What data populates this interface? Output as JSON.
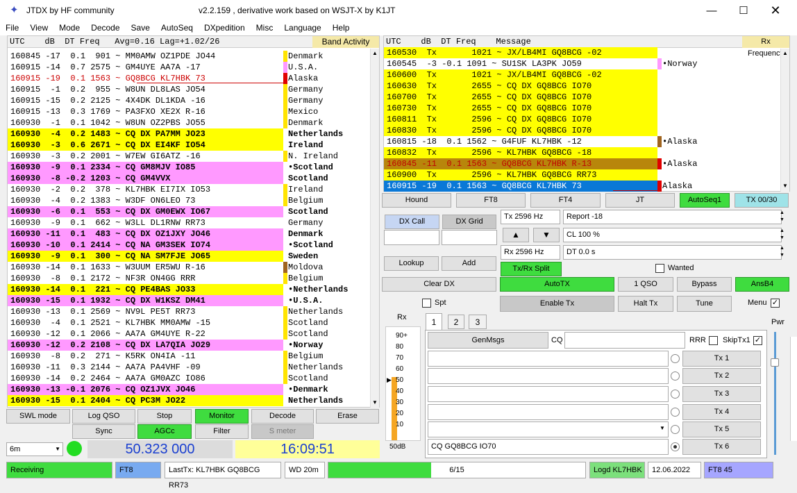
{
  "window": {
    "app_title": "JTDX  by HF community",
    "subtitle": "v2.2.159 , derivative work based on WSJT-X by K1JT"
  },
  "menu": [
    "File",
    "View",
    "Mode",
    "Decode",
    "Save",
    "AutoSeq",
    "DXpedition",
    "Misc",
    "Language",
    "Help"
  ],
  "left_panel": {
    "header": "UTC    dB  DT Freq   Avg=0.16 Lag=+1.02/26",
    "band_activity_label": "Band Activity",
    "rows": [
      {
        "text": "160845 -17  0.1  901 ~ MM0AMW OZ1PDE JO44",
        "country": "Denmark",
        "bg": "#ffffff",
        "fg": "#000",
        "marker": "#ffe400",
        "bold": false
      },
      {
        "text": "160915 -14  0.7 2575 ~ GM4UYE AA7A -17",
        "country": "U.S.A.",
        "bg": "#ffffff",
        "fg": "#000",
        "marker": "#ff99ff",
        "bold": false
      },
      {
        "text": "160915 -19  0.1 1563 ~ GQ8BCG KL7HBK 73",
        "country": "Alaska",
        "bg": "#ffffff",
        "fg": "#cc0000",
        "marker": "#e00000",
        "bold": false
      },
      {
        "text": "160915  -1  0.2  955 ~ W8UN DL8LAS JO54",
        "country": "Germany",
        "bg": "#ffffff",
        "fg": "#000",
        "marker": "#ffe400",
        "bold": false
      },
      {
        "text": "160915 -15  0.2 2125 ~ 4X4DK DL1KDA -16",
        "country": "Germany",
        "bg": "#ffffff",
        "fg": "#000",
        "marker": "#ffe400",
        "bold": false
      },
      {
        "text": "160915 -13  0.3 1769 ~ PA3FXO XE2X R-16",
        "country": "Mexico",
        "bg": "#ffffff",
        "fg": "#000",
        "marker": "#ffe400",
        "bold": false
      },
      {
        "text": "160930  -1  0.1 1042 ~ W8UN OZ2PBS JO55",
        "country": "Denmark",
        "bg": "#ffffff",
        "fg": "#000",
        "marker": "#ffe400",
        "bold": false
      },
      {
        "text": "160930  -4  0.2 1483 ~ CQ DX PA7MM JO23",
        "country": "Netherlands",
        "bg": "#ffff00",
        "fg": "#000",
        "marker": "",
        "bold": true
      },
      {
        "text": "160930  -3  0.6 2671 ~ CQ DX EI4KF IO54",
        "country": "Ireland",
        "bg": "#ffff00",
        "fg": "#000",
        "marker": "",
        "bold": true
      },
      {
        "text": "160930  -3  0.2 2001 ~ W7EW GI6ATZ -16",
        "country": "N. Ireland",
        "bg": "#ffffff",
        "fg": "#000",
        "marker": "#ffe400",
        "bold": false
      },
      {
        "text": "160930  -9  0.1 2334 ~ CQ GM8MJV IO85",
        "country": "•Scotland",
        "bg": "#ff99ff",
        "fg": "#000",
        "marker": "",
        "bold": true
      },
      {
        "text": "160930  -8 -0.2 1203 ~ CQ GM4VVX",
        "country": "Scotland",
        "bg": "#ff99ff",
        "fg": "#000",
        "marker": "",
        "bold": true
      },
      {
        "text": "160930  -2  0.2  378 ~ KL7HBK EI7IX IO53",
        "country": "Ireland",
        "bg": "#ffffff",
        "fg": "#000",
        "marker": "#ffe400",
        "bold": false
      },
      {
        "text": "160930  -4  0.2 1383 ~ W3DF ON6LEO 73",
        "country": "Belgium",
        "bg": "#ffffff",
        "fg": "#000",
        "marker": "#ffe400",
        "bold": false
      },
      {
        "text": "160930  -6  0.1  553 ~ CQ DX GM0EWX IO67",
        "country": "Scotland",
        "bg": "#ff99ff",
        "fg": "#000",
        "marker": "",
        "bold": true
      },
      {
        "text": "160930  -9  0.1  662 ~ W3LL DL1RNW RR73",
        "country": "Germany",
        "bg": "#ffffff",
        "fg": "#000",
        "marker": "",
        "bold": false
      },
      {
        "text": "160930 -11  0.1  483 ~ CQ DX OZ1JXY JO46",
        "country": "Denmark",
        "bg": "#ff99ff",
        "fg": "#000",
        "marker": "",
        "bold": true
      },
      {
        "text": "160930 -10  0.1 2414 ~ CQ NA GM3SEK IO74",
        "country": "•Scotland",
        "bg": "#ff99ff",
        "fg": "#000",
        "marker": "",
        "bold": true
      },
      {
        "text": "160930  -9  0.1  300 ~ CQ NA SM7FJE JO65",
        "country": "Sweden",
        "bg": "#ffff00",
        "fg": "#000",
        "marker": "",
        "bold": true
      },
      {
        "text": "160930 -14  0.1 1633 ~ W3UUM ER5WU R-16",
        "country": "Moldova",
        "bg": "#ffffff",
        "fg": "#000",
        "marker": "#a0641e",
        "bold": false
      },
      {
        "text": "160930  -8  0.1 2172 ~ NF3R ON4GG RRR",
        "country": "Belgium",
        "bg": "#ffffff",
        "fg": "#000",
        "marker": "#ffe400",
        "bold": false
      },
      {
        "text": "160930 -14  0.1  221 ~ CQ PE4BAS JO33",
        "country": "•Netherlands",
        "bg": "#ffff00",
        "fg": "#000",
        "marker": "",
        "bold": true
      },
      {
        "text": "160930 -15  0.1 1932 ~ CQ DX W1KSZ DM41",
        "country": "•U.S.A.",
        "bg": "#ff99ff",
        "fg": "#000",
        "marker": "",
        "bold": true
      },
      {
        "text": "160930 -13  0.1 2569 ~ NV9L PE5T RR73",
        "country": "Netherlands",
        "bg": "#ffffff",
        "fg": "#000",
        "marker": "#ffe400",
        "bold": false
      },
      {
        "text": "160930  -4  0.1 2521 ~ KL7HBK MM0AMW -15",
        "country": "Scotland",
        "bg": "#ffffff",
        "fg": "#000",
        "marker": "#ffe400",
        "bold": false
      },
      {
        "text": "160930 -12  0.1 2066 ~ AA7A GM4UYE R-22",
        "country": "Scotland",
        "bg": "#ffffff",
        "fg": "#000",
        "marker": "#ffe400",
        "bold": false
      },
      {
        "text": "160930 -12  0.2 2108 ~ CQ DX LA7QIA JO29",
        "country": "•Norway",
        "bg": "#ff99ff",
        "fg": "#000",
        "marker": "",
        "bold": true
      },
      {
        "text": "160930  -8  0.2  271 ~ K5RK ON4IA -11",
        "country": "Belgium",
        "bg": "#ffffff",
        "fg": "#000",
        "marker": "#ffe400",
        "bold": false
      },
      {
        "text": "160930 -11  0.3 2144 ~ AA7A PA4VHF -09",
        "country": "Netherlands",
        "bg": "#ffffff",
        "fg": "#000",
        "marker": "#ffe400",
        "bold": false
      },
      {
        "text": "160930 -14  0.2 2464 ~ AA7A GM0AZC IO86",
        "country": "Scotland",
        "bg": "#ffffff",
        "fg": "#000",
        "marker": "#ffe400",
        "bold": false
      },
      {
        "text": "160930 -13 -0.1 2076 ~ CQ OZ1JVX JO46",
        "country": "•Denmark",
        "bg": "#ff99ff",
        "fg": "#000",
        "marker": "",
        "bold": true
      },
      {
        "text": "160930 -15  0.1 2404 ~ CQ PC3M JO22",
        "country": "Netherlands",
        "bg": "#ffff00",
        "fg": "#000",
        "marker": "",
        "bold": true
      }
    ]
  },
  "right_panel": {
    "header": "UTC    dB  DT Freq    Message",
    "rx_frequency_label": "Rx Frequency",
    "rows": [
      {
        "text": "160530  Tx       1021 ~ JX/LB4MI GQ8BCG -02",
        "country": "",
        "bg": "#ffff00",
        "fg": "#000",
        "marker": ""
      },
      {
        "text": "160545  -3 -0.1 1091 ~ SU1SK LA3PK JO59",
        "country": "•Norway",
        "bg": "#ffffff",
        "fg": "#000",
        "marker": "#ff99ff"
      },
      {
        "text": "160600  Tx       1021 ~ JX/LB4MI GQ8BCG -02",
        "country": "",
        "bg": "#ffff00",
        "fg": "#000",
        "marker": ""
      },
      {
        "text": "160630  Tx       2655 ~ CQ DX GQ8BCG IO70",
        "country": "",
        "bg": "#ffff00",
        "fg": "#000",
        "marker": ""
      },
      {
        "text": "160700  Tx       2655 ~ CQ DX GQ8BCG IO70",
        "country": "",
        "bg": "#ffff00",
        "fg": "#000",
        "marker": ""
      },
      {
        "text": "160730  Tx       2655 ~ CQ DX GQ8BCG IO70",
        "country": "",
        "bg": "#ffff00",
        "fg": "#000",
        "marker": ""
      },
      {
        "text": "160811  Tx       2596 ~ CQ DX GQ8BCG IO70",
        "country": "",
        "bg": "#ffff00",
        "fg": "#000",
        "marker": ""
      },
      {
        "text": "160830  Tx       2596 ~ CQ DX GQ8BCG IO70",
        "country": "",
        "bg": "#ffff00",
        "fg": "#000",
        "marker": ""
      },
      {
        "text": "160815 -18  0.1 1562 ~ G4FUF KL7HBK -12",
        "country": "•Alaska",
        "bg": "#ffffff",
        "fg": "#000",
        "marker": "#a0641e"
      },
      {
        "text": "160832  Tx       2596 ~ KL7HBK GQ8BCG -18",
        "country": "",
        "bg": "#ffff00",
        "fg": "#000",
        "marker": ""
      },
      {
        "text": "160845 -11  0.1 1563 ~ GQ8BCG KL7HBK R-13",
        "country": "•Alaska",
        "bg": "#b8860b",
        "fg": "#c00000",
        "marker": "#e00000"
      },
      {
        "text": "160900  Tx       2596 ~ KL7HBK GQ8BCG RR73",
        "country": "",
        "bg": "#ffff00",
        "fg": "#000",
        "marker": ""
      },
      {
        "text": "160915 -19  0.1 1563 ~ GQ8BCG KL7HBK 73",
        "country": "Alaska",
        "bg": "#0a78d7",
        "fg": "#fff",
        "marker": "#e00000"
      }
    ]
  },
  "mode_buttons": [
    "Hound",
    "FT8",
    "FT4",
    "JT",
    "AutoSeq1",
    "TX 00/30"
  ],
  "dx_call_label": "DX Call",
  "dx_grid_label": "DX Grid",
  "tx_freq": "Tx  2596  Hz",
  "rx_freq": "Rx  2596  Hz",
  "report": "Report -18",
  "cl": "CL  100 %",
  "dt": "DT 0.0 s",
  "lookup_label": "Lookup",
  "add_label": "Add",
  "txrx_split_label": "Tx/Rx Split",
  "wanted_label": "Wanted",
  "clear_dx_label": "Clear DX",
  "autotx_label": "AutoTX",
  "one_qso_label": "1 QSO",
  "bypass_label": "Bypass",
  "ansb4_label": "AnsB4",
  "spt_label": "Spt",
  "enable_tx_label": "Enable Tx",
  "halt_tx_label": "Halt Tx",
  "tune_label": "Tune",
  "menu_label": "Menu",
  "rx_label": "Rx",
  "pwr_label": "Pwr",
  "db_label": "50dB",
  "meter_ticks": [
    "90+",
    "80",
    "70",
    "60",
    "50",
    "40",
    "30",
    "20",
    "10"
  ],
  "tabs": [
    "1",
    "2",
    "3"
  ],
  "genmsgs_label": "GenMsgs",
  "cq_label": "CQ",
  "rrr_label": "RRR",
  "skiptx1_label": "SkipTx1",
  "tx_buttons": [
    "Tx 1",
    "Tx 2",
    "Tx 3",
    "Tx 4",
    "Tx 5",
    "Tx 6"
  ],
  "tx6_message": "CQ GQ8BCG IO70",
  "bottom_buttons_row1": [
    "SWL mode",
    "Log QSO",
    "Stop",
    "Monitor",
    "Decode",
    "Erase"
  ],
  "bottom_buttons_row2": [
    "Sync",
    "AGCc",
    "Filter",
    "S meter"
  ],
  "band": "6m",
  "dial_freq": "50.323 000",
  "clock": "16:09:51",
  "status": {
    "receiving": "Receiving",
    "mode": "FT8",
    "last_tx": "LastTx: KL7HBK GQ8BCG RR73",
    "wd": "WD 20m",
    "progress_text": "6/15",
    "progress": 0.4,
    "logd": "Logd KL7HBK",
    "date": "12.06.2022",
    "mode_period": "FT8  45"
  }
}
